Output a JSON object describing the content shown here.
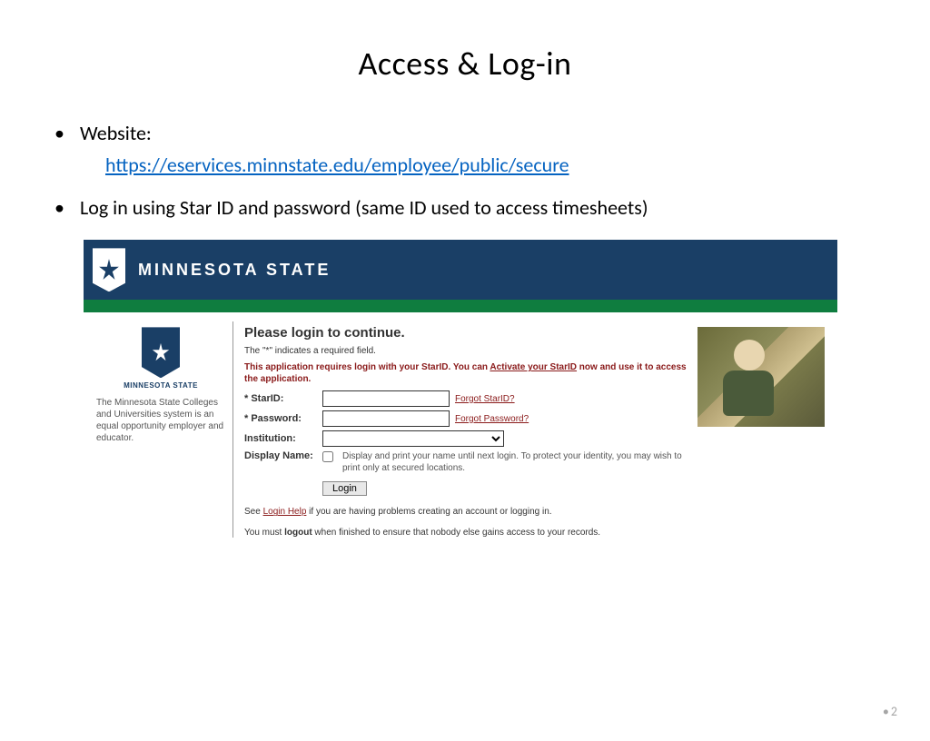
{
  "slide": {
    "title": "Access & Log-in",
    "page_number": "2",
    "bullets": [
      {
        "label": "Website:",
        "url": "https://eservices.minnstate.edu/employee/public/secure"
      },
      {
        "label": "Log in using Star ID and password (same ID used to access timesheets)"
      }
    ]
  },
  "screenshot": {
    "banner_title": "MINNESOTA STATE",
    "side": {
      "brand": "MINNESOTA STATE",
      "blurb": "The Minnesota State Colleges and Universities system is an equal opportunity employer and educator."
    },
    "login": {
      "heading": "Please login to continue.",
      "required_note": "The \"*\" indicates a required field.",
      "red_note_pre": "This application requires login with your StarID. You can ",
      "red_note_link": "Activate your StarID",
      "red_note_post": " now and use it to access the application.",
      "starid_label": "* StarID:",
      "forgot_starid": "Forgot StarID?",
      "password_label": "* Password:",
      "forgot_password": "Forgot Password?",
      "institution_label": "Institution:",
      "display_label": "Display Name:",
      "display_note": "Display and print your name until next login. To protect your identity, you may wish to print only at secured locations.",
      "login_button": "Login",
      "help_pre": "See ",
      "help_link": "Login Help",
      "help_post": " if you are having problems creating an account or logging in.",
      "logout_pre": "You must ",
      "logout_bold": "logout",
      "logout_post": " when finished to ensure that nobody else gains access to your records."
    }
  }
}
